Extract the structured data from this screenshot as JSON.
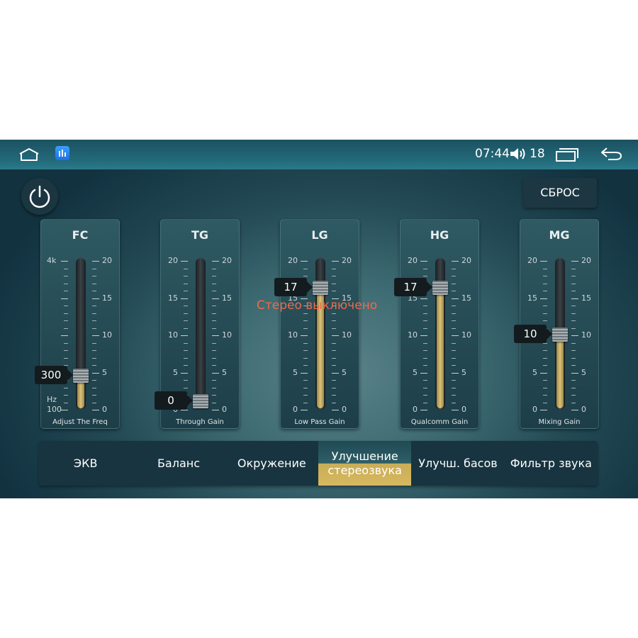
{
  "status_bar": {
    "time": "07:44",
    "volume": "18",
    "icons": [
      "home-icon",
      "app-icon",
      "volume-icon",
      "recent-apps-icon",
      "back-icon"
    ]
  },
  "header": {
    "reset_label": "СБРОС"
  },
  "message": "Стерео выключено",
  "sliders": [
    {
      "title": "FC",
      "subtitle": "Adjust The Freq",
      "value": "300",
      "fraction": 0.19,
      "left_scale": [
        "4k",
        "Hz",
        "100"
      ],
      "right_scale": [
        "20",
        "15",
        "10",
        "5",
        "0"
      ]
    },
    {
      "title": "TG",
      "subtitle": "Through Gain",
      "value": "0",
      "fraction": 0.0,
      "left_scale": [
        "20",
        "15",
        "10",
        "5",
        "0"
      ],
      "right_scale": [
        "20",
        "15",
        "10",
        "5",
        "0"
      ]
    },
    {
      "title": "LG",
      "subtitle": "Low Pass Gain",
      "value": "17",
      "fraction": 0.85,
      "left_scale": [
        "20",
        "15",
        "10",
        "5",
        "0"
      ],
      "right_scale": [
        "20",
        "15",
        "10",
        "5",
        "0"
      ]
    },
    {
      "title": "HG",
      "subtitle": "Qualcomm Gain",
      "value": "17",
      "fraction": 0.85,
      "left_scale": [
        "20",
        "15",
        "10",
        "5",
        "0"
      ],
      "right_scale": [
        "20",
        "15",
        "10",
        "5",
        "0"
      ]
    },
    {
      "title": "MG",
      "subtitle": "Mixing Gain",
      "value": "10",
      "fraction": 0.5,
      "left_scale": [
        "20",
        "15",
        "10",
        "5",
        "0"
      ],
      "right_scale": [
        "20",
        "15",
        "10",
        "5",
        "0"
      ]
    }
  ],
  "tabs": [
    {
      "label": "ЭКВ",
      "active": false
    },
    {
      "label": "Баланс",
      "active": false
    },
    {
      "label": "Окружение",
      "active": false
    },
    {
      "label": "Улучшение\nстереозвука",
      "active": true
    },
    {
      "label": "Улучш. басов",
      "active": false
    },
    {
      "label": "Фильтр звука",
      "active": false
    }
  ],
  "colors": {
    "accent_gold": "#d6b85f",
    "message_red": "#ef6a4a",
    "panel_dark": "#1d3e48"
  }
}
